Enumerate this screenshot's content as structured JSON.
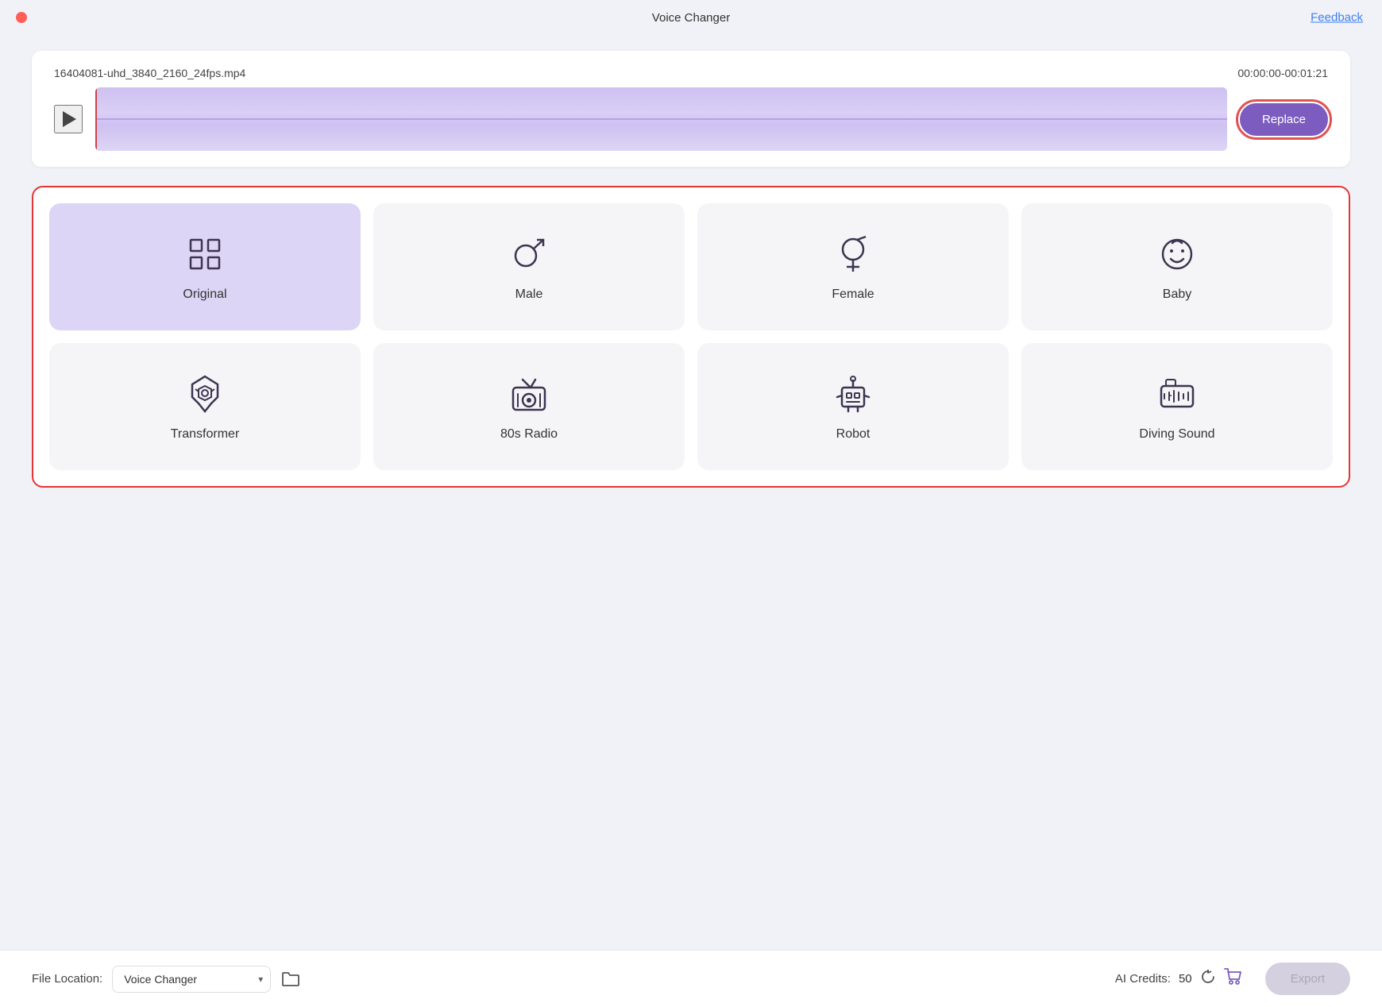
{
  "app": {
    "title": "Voice Changer",
    "feedback_label": "Feedback"
  },
  "video": {
    "filename": "16404081-uhd_3840_2160_24fps.mp4",
    "duration": "00:00:00-00:01:21",
    "replace_label": "Replace"
  },
  "effects": [
    {
      "id": "original",
      "label": "Original",
      "active": true
    },
    {
      "id": "male",
      "label": "Male",
      "active": false
    },
    {
      "id": "female",
      "label": "Female",
      "active": false
    },
    {
      "id": "baby",
      "label": "Baby",
      "active": false
    },
    {
      "id": "transformer",
      "label": "Transformer",
      "active": false
    },
    {
      "id": "radio80s",
      "label": "80s Radio",
      "active": false
    },
    {
      "id": "robot",
      "label": "Robot",
      "active": false
    },
    {
      "id": "diving_sound",
      "label": "Diving Sound",
      "active": false
    }
  ],
  "bottom": {
    "file_location_label": "File Location:",
    "file_location_value": "Voice Changer",
    "ai_credits_label": "AI Credits:",
    "ai_credits_count": "50",
    "export_label": "Export"
  }
}
